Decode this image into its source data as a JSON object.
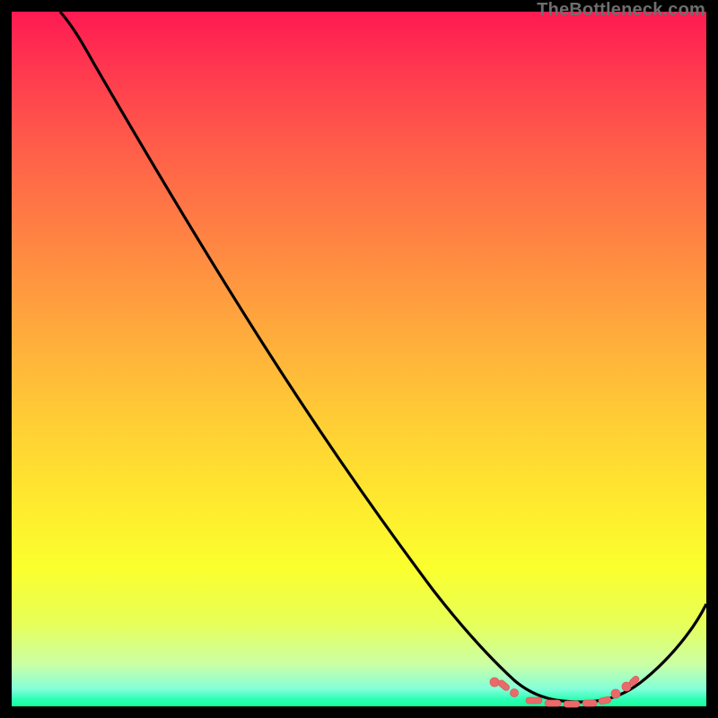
{
  "watermark": "TheBottleneck.com",
  "colors": {
    "background_frame": "#000000",
    "curve_stroke": "#000000",
    "points_fill": "#ea6a6a",
    "gradient_top": "#ff1a52",
    "gradient_bottom": "#14ff9a"
  },
  "chart_data": {
    "type": "line",
    "title": "",
    "xlabel": "",
    "ylabel": "",
    "xlim": [
      0,
      100
    ],
    "ylim": [
      0,
      100
    ],
    "grid": false,
    "legend": false,
    "note": "Axes unlabeled; values are percent positions read off the 774×774 plot area (origin at top-left)",
    "series": [
      {
        "name": "bottleneck-curve",
        "x": [
          7,
          10,
          15,
          20,
          25,
          30,
          35,
          40,
          45,
          50,
          55,
          60,
          65,
          70,
          73,
          76,
          80,
          84,
          88,
          92,
          96,
          100
        ],
        "y": [
          0,
          4,
          11,
          20,
          29,
          38,
          47,
          56,
          65,
          73,
          81,
          88,
          93,
          97,
          98.5,
          99,
          99.2,
          99,
          97.5,
          94,
          89,
          82
        ]
      }
    ],
    "highlight_points": {
      "name": "bottom-cluster-markers",
      "x": [
        69.5,
        71,
        74,
        76,
        78,
        80,
        82,
        84,
        86,
        88,
        89.5
      ],
      "y": [
        96.5,
        98,
        99,
        99.2,
        99.3,
        99.3,
        99.2,
        99,
        98.3,
        97,
        95.5
      ]
    }
  }
}
